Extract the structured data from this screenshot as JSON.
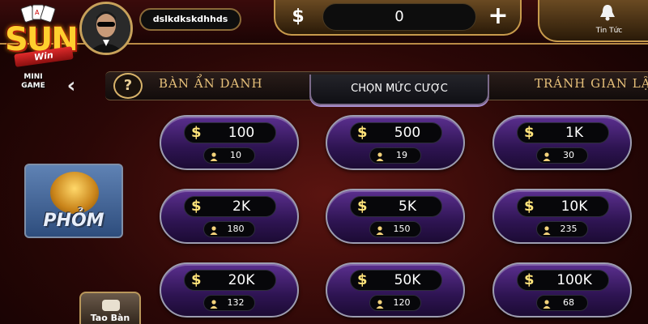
{
  "header": {
    "logo": {
      "brand": "SUN",
      "sub": "Win",
      "mini": "MINI GAME"
    },
    "username": "dslkdkskdhhds",
    "balance": {
      "currency_icon": "$",
      "value": "0",
      "add_icon": "+"
    },
    "news_label": "Tin Tức"
  },
  "tabs": {
    "help_icon": "?",
    "anonymous": "BÀN ẨN DANH",
    "choose_bet": "CHỌN MỨC CƯỢC",
    "avoid_cheat": "TRÁNH GIAN LẬN"
  },
  "game": {
    "name": "PHỎM"
  },
  "create_table_label": "Tao Bàn",
  "bets": [
    {
      "amount": "100",
      "players": "10"
    },
    {
      "amount": "500",
      "players": "19"
    },
    {
      "amount": "1K",
      "players": "30"
    },
    {
      "amount": "2K",
      "players": "180"
    },
    {
      "amount": "5K",
      "players": "150"
    },
    {
      "amount": "10K",
      "players": "235"
    },
    {
      "amount": "20K",
      "players": "132"
    },
    {
      "amount": "50K",
      "players": "120"
    },
    {
      "amount": "100K",
      "players": "68"
    }
  ],
  "currency_symbol": "$",
  "colors": {
    "accent_gold": "#c79a4c",
    "card_purple": "#5b2f8f",
    "dollar_yellow": "#ffe37a"
  }
}
